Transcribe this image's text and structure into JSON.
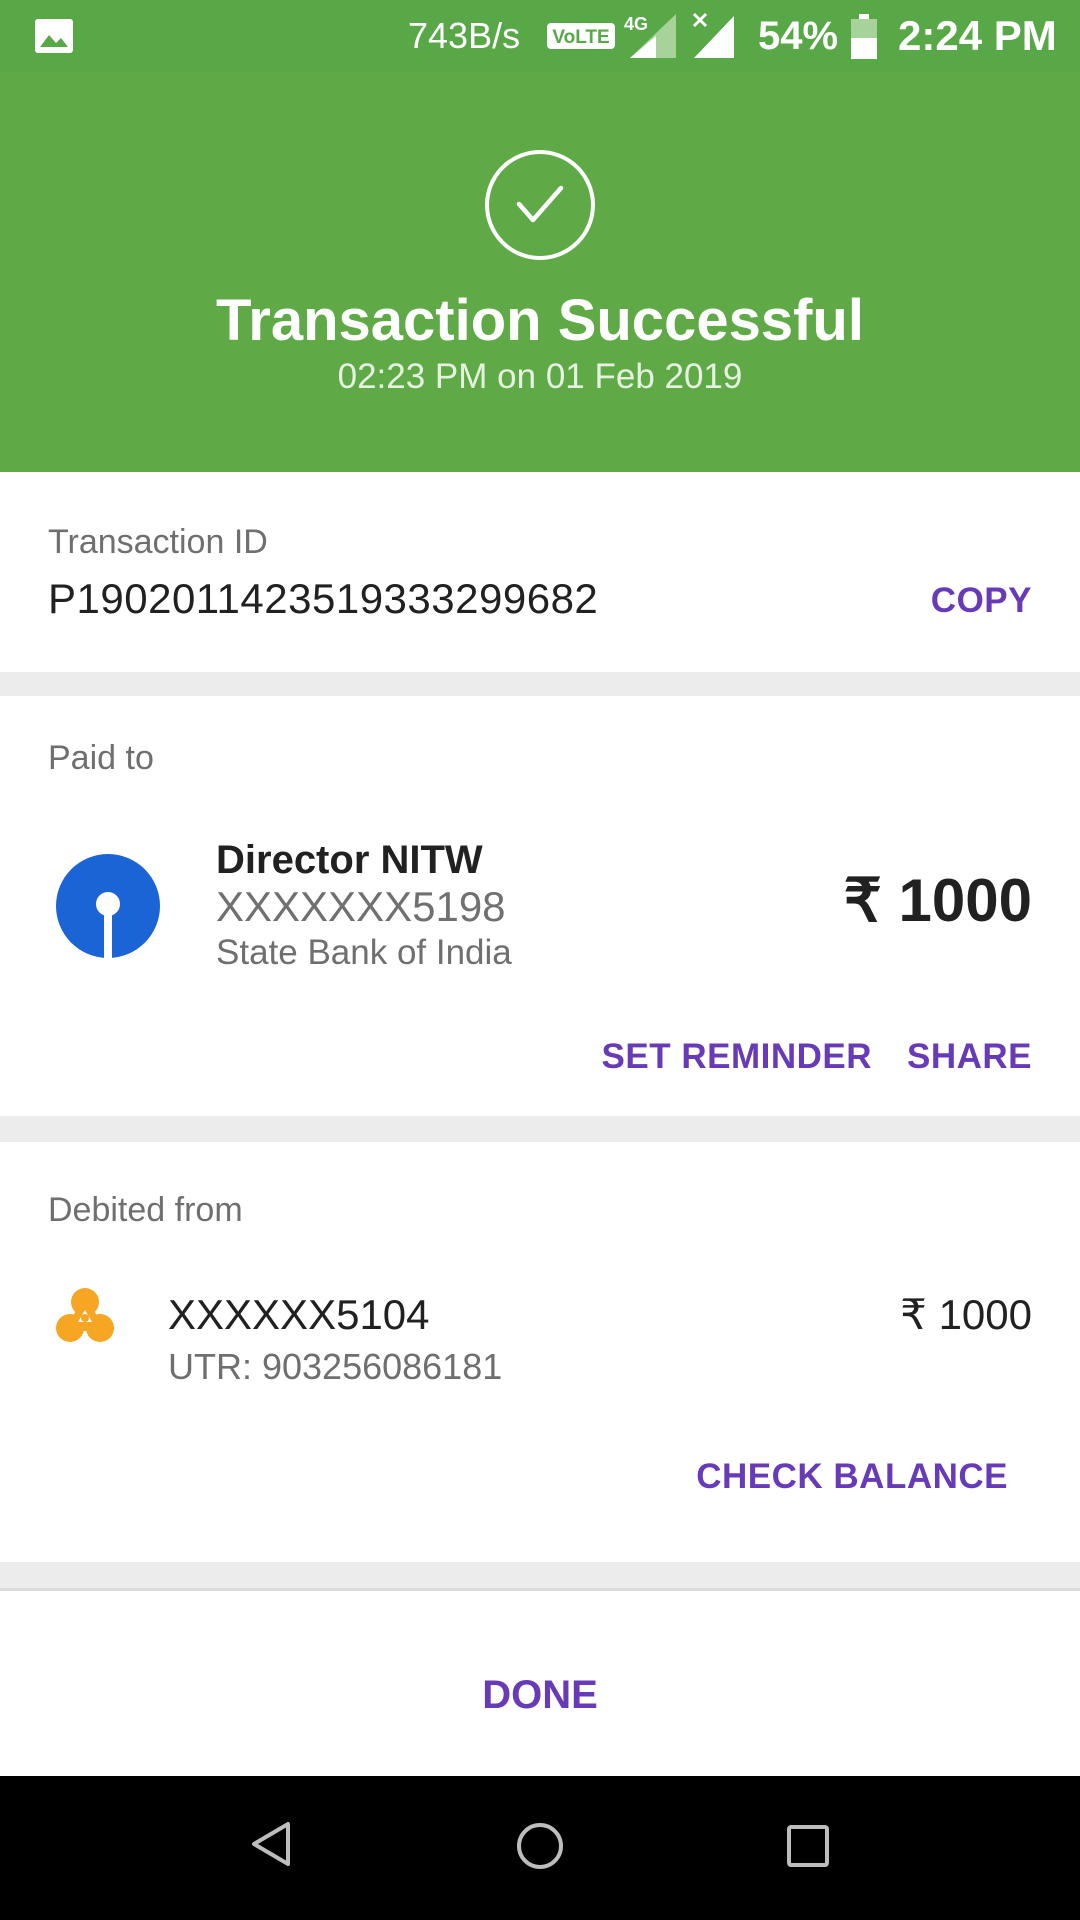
{
  "status_bar": {
    "net_speed": "743B/s",
    "volte": "VoLTE",
    "network": "4G",
    "battery_pct": "54%",
    "time": "2:24 PM",
    "icons": [
      "gallery-icon",
      "volte-icon",
      "signal-icon",
      "no-signal-icon",
      "battery-icon"
    ]
  },
  "hero": {
    "title": "Transaction Successful",
    "subtitle": "02:23 PM on 01 Feb 2019",
    "icon": "checkmark-icon",
    "bg_color": "#5faa47"
  },
  "transaction": {
    "label": "Transaction ID",
    "id": "P1902011423519333299682",
    "copy_label": "COPY"
  },
  "paid_to": {
    "label": "Paid to",
    "name": "Director NITW",
    "account": "XXXXXXX5198",
    "bank": "State Bank of India",
    "amount": "₹ 1000",
    "logo": "sbi-logo",
    "set_reminder_label": "SET REMINDER",
    "share_label": "SHARE"
  },
  "debited_from": {
    "label": "Debited from",
    "account": "XXXXXX5104",
    "utr": "UTR: 903256086181",
    "amount": "₹ 1000",
    "logo": "bank-logo",
    "check_balance_label": "CHECK BALANCE"
  },
  "footer": {
    "done_label": "DONE"
  },
  "colors": {
    "accent": "#673ab7",
    "success": "#5faa47",
    "sbi_blue": "#1a64d6",
    "bank_orange": "#f6a623"
  },
  "nav_bar": {
    "icons": [
      "back-icon",
      "home-icon",
      "recents-icon"
    ]
  }
}
